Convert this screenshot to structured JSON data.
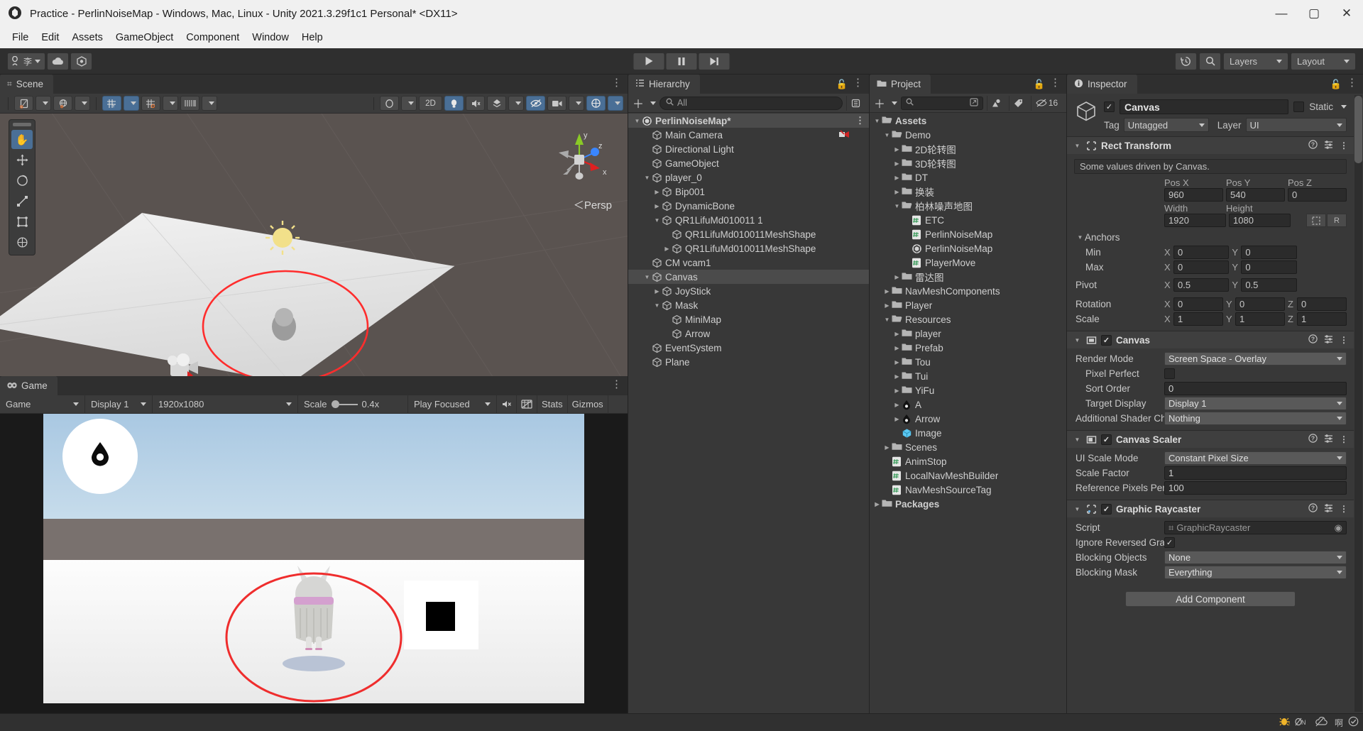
{
  "window": {
    "title": "Practice - PerlinNoiseMap - Windows, Mac, Linux - Unity 2021.3.29f1c1 Personal* <DX11>",
    "minimize": "—",
    "maximize": "▢",
    "close": "✕"
  },
  "menu": {
    "items": [
      "File",
      "Edit",
      "Assets",
      "GameObject",
      "Component",
      "Window",
      "Help"
    ]
  },
  "toolbar": {
    "account_label": "李",
    "cloud_icon": "cloud-icon",
    "settings_icon": "unity-services-icon",
    "play": "▶",
    "pause": "❙❙",
    "step": "▶❙",
    "history_icon": "history-icon",
    "search_icon": "search-icon",
    "layers": "Layers",
    "layout": "Layout"
  },
  "scene": {
    "tab": "Scene",
    "tools": [
      "hand-tool",
      "move-tool",
      "rotate-tool",
      "scale-tool",
      "rect-tool",
      "transform-tool"
    ],
    "toolbar": {
      "pivot_mode": "pivot-center-icon",
      "pivot_rotation": "global-local-icon",
      "grid_axis": "grid-y-icon",
      "snap": "grid-snap-icon",
      "ruler": "ruler-icon",
      "draw_mode": "shaded-icon",
      "twod": "2D",
      "lighting": "light-icon",
      "audio": "audio-icon",
      "fx": "effects-icon",
      "hidden": "visibility-icon",
      "camera": "camera-icon",
      "gizmos": "gizmos-icon"
    },
    "persp_label": "Persp",
    "axis": {
      "x": "x",
      "y": "y",
      "z": "z"
    }
  },
  "game": {
    "tab": "Game",
    "display_mode": "Game",
    "display": "Display 1",
    "resolution": "1920x1080",
    "scale_label": "Scale",
    "scale_value": "0.4x",
    "play_focused": "Play Focused",
    "mute_icon": "mute-audio-icon",
    "render_icon": "render-doc-icon",
    "stats": "Stats",
    "gizmos": "Gizmos"
  },
  "hierarchy": {
    "tab": "Hierarchy",
    "search_placeholder": "All",
    "items": [
      {
        "label": "PerlinNoiseMap*",
        "depth": 0,
        "twisty": "down",
        "icon": "unity-scene-icon",
        "selected": false,
        "root": true,
        "dots": true
      },
      {
        "label": "Main Camera",
        "depth": 1,
        "twisty": "none",
        "icon": "gameobject-icon",
        "badge": "camera-badge"
      },
      {
        "label": "Directional Light",
        "depth": 1,
        "twisty": "none",
        "icon": "gameobject-icon"
      },
      {
        "label": "GameObject",
        "depth": 1,
        "twisty": "none",
        "icon": "gameobject-icon"
      },
      {
        "label": "player_0",
        "depth": 1,
        "twisty": "down",
        "icon": "gameobject-icon"
      },
      {
        "label": "Bip001",
        "depth": 2,
        "twisty": "right",
        "icon": "gameobject-icon"
      },
      {
        "label": "DynamicBone",
        "depth": 2,
        "twisty": "right",
        "icon": "gameobject-icon"
      },
      {
        "label": "QR1LifuMd010011 1",
        "depth": 2,
        "twisty": "down",
        "icon": "gameobject-icon"
      },
      {
        "label": "QR1LifuMd010011MeshShape",
        "depth": 3,
        "twisty": "none",
        "icon": "gameobject-icon"
      },
      {
        "label": "QR1LifuMd010011MeshShape",
        "depth": 3,
        "twisty": "right",
        "icon": "gameobject-icon"
      },
      {
        "label": "CM vcam1",
        "depth": 1,
        "twisty": "none",
        "icon": "gameobject-icon"
      },
      {
        "label": "Canvas",
        "depth": 1,
        "twisty": "down",
        "icon": "gameobject-icon",
        "selected": true
      },
      {
        "label": "JoyStick",
        "depth": 2,
        "twisty": "right",
        "icon": "gameobject-icon"
      },
      {
        "label": "Mask",
        "depth": 2,
        "twisty": "down",
        "icon": "gameobject-icon"
      },
      {
        "label": "MiniMap",
        "depth": 3,
        "twisty": "none",
        "icon": "gameobject-icon"
      },
      {
        "label": "Arrow",
        "depth": 3,
        "twisty": "none",
        "icon": "gameobject-icon"
      },
      {
        "label": "EventSystem",
        "depth": 1,
        "twisty": "none",
        "icon": "gameobject-icon"
      },
      {
        "label": "Plane",
        "depth": 1,
        "twisty": "none",
        "icon": "gameobject-icon"
      }
    ]
  },
  "project": {
    "tab": "Project",
    "search_placeholder": "",
    "hidden_count": "16",
    "items": [
      {
        "label": "Assets",
        "depth": 0,
        "twisty": "down",
        "icon": "folder-open",
        "bold": true
      },
      {
        "label": "Demo",
        "depth": 1,
        "twisty": "down",
        "icon": "folder-open"
      },
      {
        "label": "2D轮转图",
        "depth": 2,
        "twisty": "right",
        "icon": "folder"
      },
      {
        "label": "3D轮转图",
        "depth": 2,
        "twisty": "right",
        "icon": "folder"
      },
      {
        "label": "DT",
        "depth": 2,
        "twisty": "right",
        "icon": "folder"
      },
      {
        "label": "换装",
        "depth": 2,
        "twisty": "right",
        "icon": "folder"
      },
      {
        "label": "柏林噪声地图",
        "depth": 2,
        "twisty": "down",
        "icon": "folder-open"
      },
      {
        "label": "ETC",
        "depth": 3,
        "twisty": "none",
        "icon": "script"
      },
      {
        "label": "PerlinNoiseMap",
        "depth": 3,
        "twisty": "none",
        "icon": "script"
      },
      {
        "label": "PerlinNoiseMap",
        "depth": 3,
        "twisty": "none",
        "icon": "unity-scene"
      },
      {
        "label": "PlayerMove",
        "depth": 3,
        "twisty": "none",
        "icon": "script"
      },
      {
        "label": "雷达图",
        "depth": 2,
        "twisty": "right",
        "icon": "folder"
      },
      {
        "label": "NavMeshComponents",
        "depth": 1,
        "twisty": "right",
        "icon": "folder"
      },
      {
        "label": "Player",
        "depth": 1,
        "twisty": "right",
        "icon": "folder"
      },
      {
        "label": "Resources",
        "depth": 1,
        "twisty": "down",
        "icon": "folder-open"
      },
      {
        "label": "player",
        "depth": 2,
        "twisty": "right",
        "icon": "folder"
      },
      {
        "label": "Prefab",
        "depth": 2,
        "twisty": "right",
        "icon": "folder"
      },
      {
        "label": "Tou",
        "depth": 2,
        "twisty": "right",
        "icon": "folder"
      },
      {
        "label": "Tui",
        "depth": 2,
        "twisty": "right",
        "icon": "folder"
      },
      {
        "label": "YiFu",
        "depth": 2,
        "twisty": "right",
        "icon": "folder"
      },
      {
        "label": "A",
        "depth": 2,
        "twisty": "right",
        "icon": "sprite"
      },
      {
        "label": "Arrow",
        "depth": 2,
        "twisty": "right",
        "icon": "sprite"
      },
      {
        "label": "Image",
        "depth": 2,
        "twisty": "none",
        "icon": "prefab"
      },
      {
        "label": "Scenes",
        "depth": 1,
        "twisty": "right",
        "icon": "folder"
      },
      {
        "label": "AnimStop",
        "depth": 1,
        "twisty": "none",
        "icon": "script"
      },
      {
        "label": "LocalNavMeshBuilder",
        "depth": 1,
        "twisty": "none",
        "icon": "script"
      },
      {
        "label": "NavMeshSourceTag",
        "depth": 1,
        "twisty": "none",
        "icon": "script"
      },
      {
        "label": "Packages",
        "depth": 0,
        "twisty": "right",
        "icon": "folder",
        "bold": true
      }
    ]
  },
  "inspector": {
    "tab": "Inspector",
    "object": {
      "enabled": true,
      "name": "Canvas",
      "static_label": "Static",
      "tag_label": "Tag",
      "tag_value": "Untagged",
      "layer_label": "Layer",
      "layer_value": "UI"
    },
    "rect_transform": {
      "title": "Rect Transform",
      "info": "Some values driven by Canvas.",
      "col_headers_1": [
        "Pos X",
        "Pos Y",
        "Pos Z"
      ],
      "pos": [
        "960",
        "540",
        "0"
      ],
      "col_headers_2": [
        "Width",
        "Height"
      ],
      "size": [
        "1920",
        "1080"
      ],
      "anchor_btn_1": "anchor-preset-icon",
      "anchor_btn_2": "R",
      "anchors_label": "Anchors",
      "min_label": "Min",
      "min": [
        "0",
        "0"
      ],
      "max_label": "Max",
      "max": [
        "0",
        "0"
      ],
      "pivot_label": "Pivot",
      "pivot": [
        "0.5",
        "0.5"
      ],
      "rotation_label": "Rotation",
      "rotation": [
        "0",
        "0",
        "0"
      ],
      "scale_label": "Scale",
      "scale": [
        "1",
        "1",
        "1"
      ]
    },
    "canvas": {
      "title": "Canvas",
      "enabled": true,
      "fields": [
        {
          "label": "Render Mode",
          "value": "Screen Space - Overlay",
          "type": "dropdown",
          "indent": 0
        },
        {
          "label": "Pixel Perfect",
          "value": "",
          "type": "checkbox",
          "checked": false,
          "indent": 1
        },
        {
          "label": "Sort Order",
          "value": "0",
          "type": "text",
          "indent": 1
        },
        {
          "label": "Target Display",
          "value": "Display 1",
          "type": "dropdown",
          "indent": 1
        },
        {
          "label": "Additional Shader Ch",
          "value": "Nothing",
          "type": "dropdown",
          "indent": 0
        }
      ]
    },
    "canvas_scaler": {
      "title": "Canvas Scaler",
      "enabled": true,
      "fields": [
        {
          "label": "UI Scale Mode",
          "value": "Constant Pixel Size",
          "type": "dropdown",
          "indent": 0
        },
        {
          "label": "Scale Factor",
          "value": "1",
          "type": "text",
          "indent": 0
        },
        {
          "label": "Reference Pixels Per",
          "value": "100",
          "type": "text",
          "indent": 0
        }
      ]
    },
    "graphic_raycaster": {
      "title": "Graphic Raycaster",
      "enabled": true,
      "fields": [
        {
          "label": "Script",
          "value": "GraphicRaycaster",
          "type": "object",
          "indent": 0
        },
        {
          "label": "Ignore Reversed Grap",
          "value": "",
          "type": "checkbox",
          "checked": true,
          "indent": 0
        },
        {
          "label": "Blocking Objects",
          "value": "None",
          "type": "dropdown",
          "indent": 0
        },
        {
          "label": "Blocking Mask",
          "value": "Everything",
          "type": "dropdown",
          "indent": 0
        }
      ]
    },
    "add_component": "Add Component"
  },
  "statusbar": {
    "icons": [
      "bug-icon",
      "collab-icon",
      "cloud-icon",
      "account-icon",
      "ready-icon"
    ]
  },
  "colors": {
    "accent_blue": "#4a6f96",
    "selection_gray": "#4b4b4b",
    "panel_bg": "#383838",
    "gizmo_red": "#ff3b30",
    "script_green": "#3c9c5c"
  }
}
